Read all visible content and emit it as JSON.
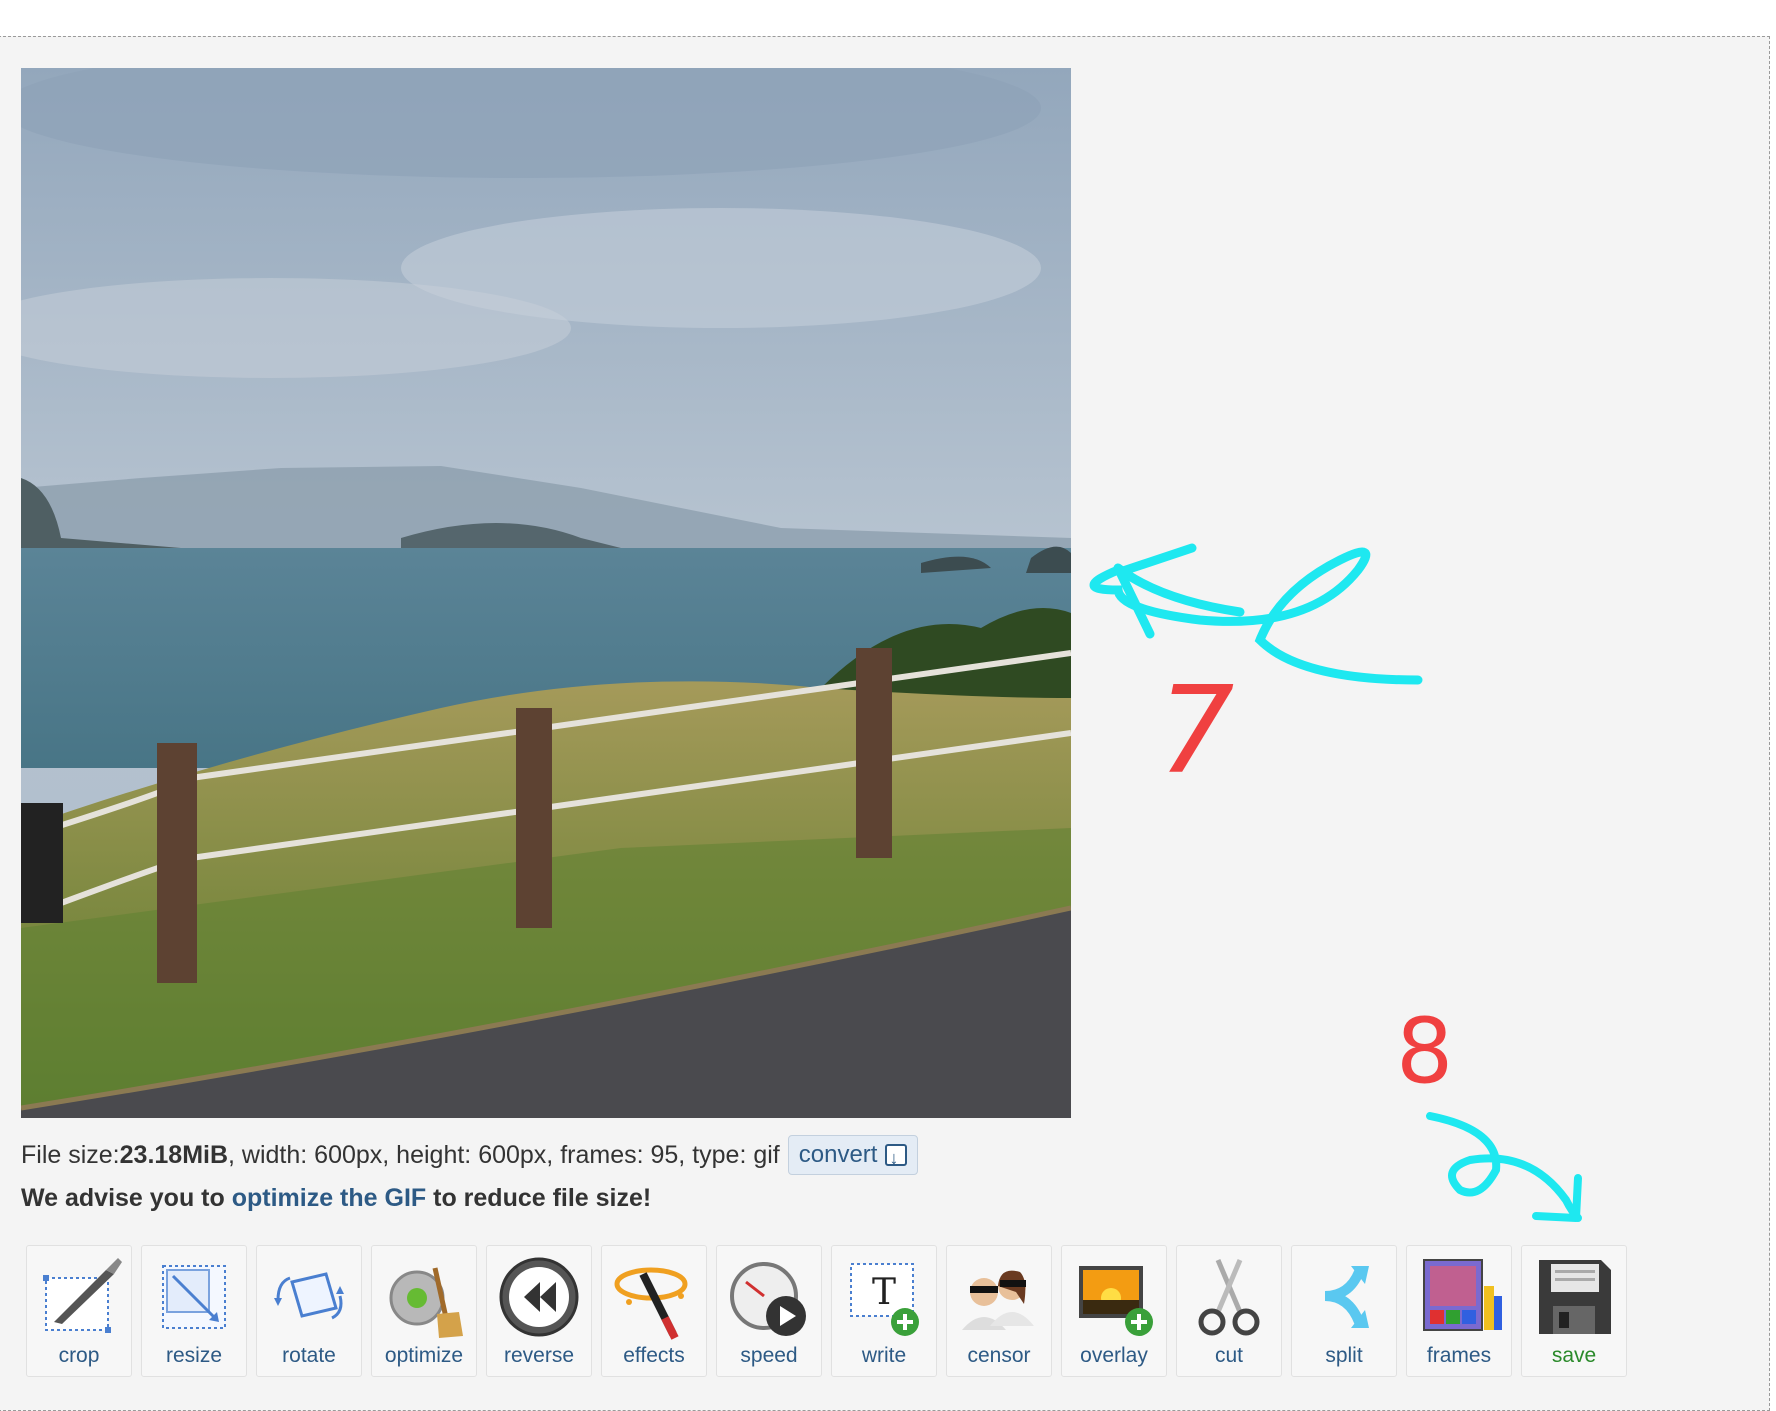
{
  "file_info": {
    "prefix": "File size: ",
    "size": "23.18MiB",
    "details": ", width: 600px, height: 600px, frames: 95, type: gif",
    "convert_label": "convert"
  },
  "advice": {
    "before": "We advise you to ",
    "link": "optimize the GIF",
    "after": " to reduce file size!"
  },
  "tools": [
    {
      "label": "crop",
      "icon": "crop-icon"
    },
    {
      "label": "resize",
      "icon": "resize-icon"
    },
    {
      "label": "rotate",
      "icon": "rotate-icon"
    },
    {
      "label": "optimize",
      "icon": "optimize-icon"
    },
    {
      "label": "reverse",
      "icon": "reverse-icon"
    },
    {
      "label": "effects",
      "icon": "effects-icon"
    },
    {
      "label": "speed",
      "icon": "speed-icon"
    },
    {
      "label": "write",
      "icon": "write-icon"
    },
    {
      "label": "censor",
      "icon": "censor-icon"
    },
    {
      "label": "overlay",
      "icon": "overlay-icon"
    },
    {
      "label": "cut",
      "icon": "cut-icon"
    },
    {
      "label": "split",
      "icon": "split-icon"
    },
    {
      "label": "frames",
      "icon": "frames-icon"
    },
    {
      "label": "save",
      "icon": "save-icon"
    }
  ],
  "annotations": {
    "step_seven": "7",
    "step_eight": "8"
  },
  "colors": {
    "link": "#2d5a85",
    "save": "#2a8a2a",
    "annotation_arrow": "#1ee8f0",
    "annotation_number": "#f04040"
  }
}
